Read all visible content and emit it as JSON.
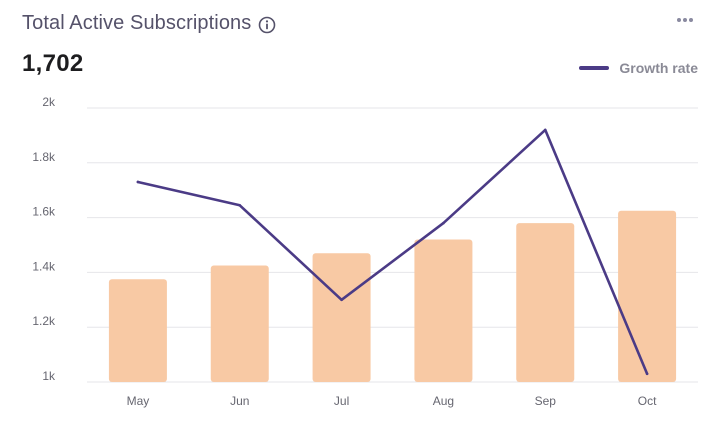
{
  "header": {
    "title": "Total Active Subscriptions",
    "value": "1,702"
  },
  "icons": {
    "info": "info-icon",
    "more": "more-horizontal-icon"
  },
  "colors": {
    "bar": "#f8c9a4",
    "line": "#4b3b86",
    "grid": "#e6e6ea",
    "tick": "#666670"
  },
  "chart_data": {
    "type": "bar",
    "categories": [
      "May",
      "Jun",
      "Jul",
      "Aug",
      "Sep",
      "Oct"
    ],
    "ylim": [
      1000,
      2000
    ],
    "yticks": [
      1000,
      1200,
      1400,
      1600,
      1800,
      2000
    ],
    "ytick_labels": [
      "1k",
      "1.2k",
      "1.4k",
      "1.6k",
      "1.8k",
      "2k"
    ],
    "grid": true,
    "legend_position": "top-right",
    "series": [
      {
        "type": "bar",
        "values": [
          1375,
          1425,
          1470,
          1520,
          1580,
          1625
        ]
      },
      {
        "type": "line",
        "name": "Growth rate",
        "values": [
          1730,
          1645,
          1300,
          1580,
          1920,
          1030
        ]
      }
    ]
  }
}
